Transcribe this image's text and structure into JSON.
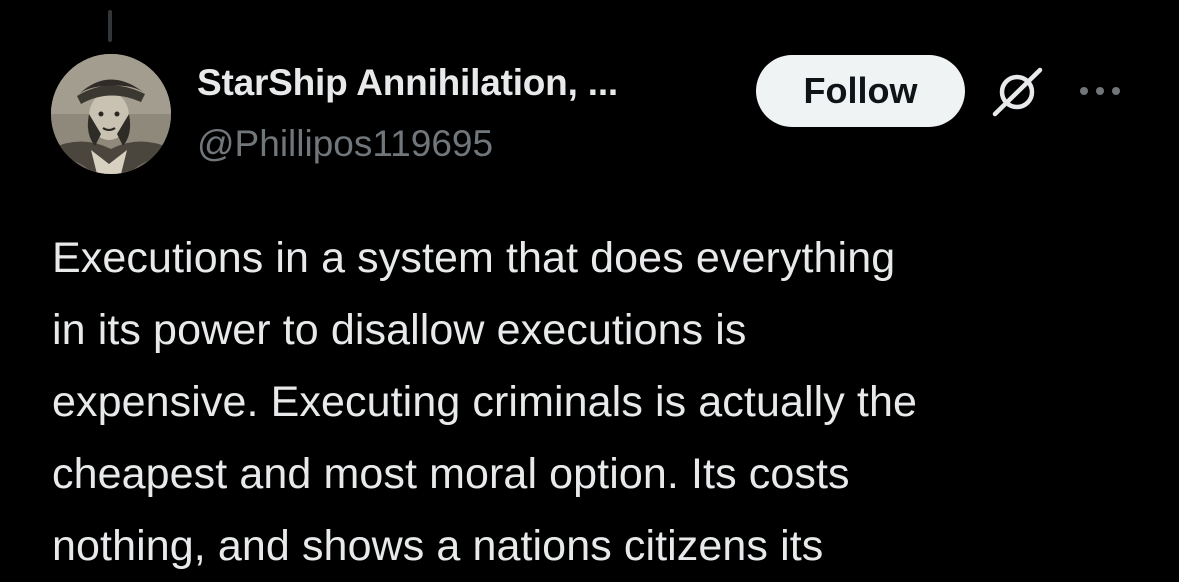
{
  "post": {
    "author": {
      "display_name": "StarShip Annihilation, ...",
      "handle": "@Phillipos119695"
    },
    "follow_label": "Follow",
    "icons": {
      "grok": "grok-icon",
      "more": "more-options-icon"
    },
    "text": "Executions in a system that does everything\nin its power to disallow executions is\nexpensive. Executing criminals is actually the\ncheapest and most moral option. Its costs\nnothing, and shows a nations citizens its"
  },
  "colors": {
    "background": "#000000",
    "primary_text": "#e7e9ea",
    "secondary_text": "#71767b",
    "follow_button_bg": "#eff3f4",
    "follow_button_text": "#0f1419",
    "thread_line": "#333639"
  }
}
